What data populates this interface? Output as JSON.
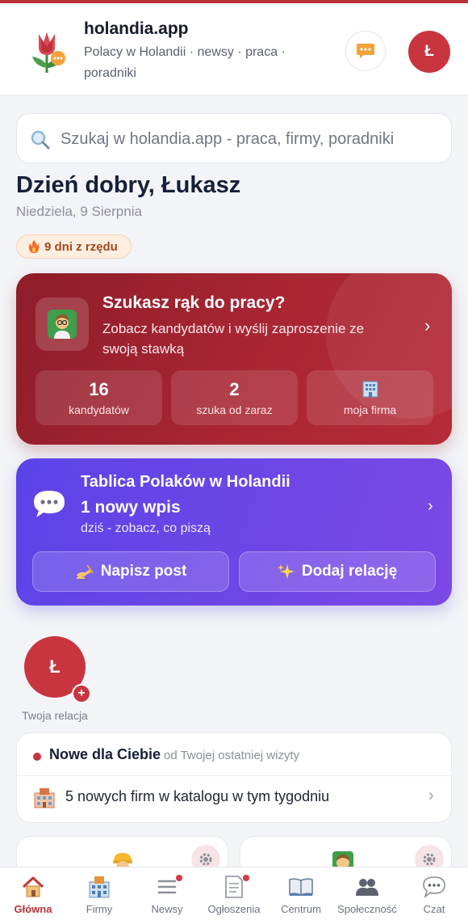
{
  "header": {
    "title": "holandia.app",
    "subtitle": "Polacy w Holandii · newsy · praca · poradniki",
    "avatar_initial": "Ł"
  },
  "search": {
    "placeholder": "Szukaj w holandia.app - praca, firmy, poradniki"
  },
  "greeting": {
    "title": "Dzień dobry, Łukasz",
    "date": "Niedziela, 9 Sierpnia",
    "streak": "9 dni z rzędu"
  },
  "employer_card": {
    "title": "Szukasz rąk do pracy?",
    "subtitle": "Zobacz kandydatów i wyślij zaproszenie ze swoją stawką",
    "stats": [
      {
        "value": "16",
        "label": "kandydatów"
      },
      {
        "value": "2",
        "label": "szuka od zaraz"
      },
      {
        "value": "",
        "label": "moja firma",
        "icon": "office-building-icon"
      }
    ]
  },
  "board_card": {
    "title": "Tablica Polaków w Holandii",
    "new_posts": "1 nowy wpis",
    "subtitle": "dziś - zobacz, co piszą",
    "write_post": "Napisz post",
    "add_story": "Dodaj relację"
  },
  "story": {
    "initial": "Ł",
    "label": "Twoja relacja"
  },
  "new_for_you": {
    "title": "Nowe dla Ciebie",
    "subtitle": "od Twojej ostatniej wizyty",
    "items": [
      {
        "text": "5 nowych firm w katalogu w tym tygodniu",
        "icon": "building-icon"
      }
    ]
  },
  "bottom_nav": [
    {
      "label": "Główna",
      "icon": "home-icon",
      "active": true
    },
    {
      "label": "Firmy",
      "icon": "building-icon"
    },
    {
      "label": "Newsy",
      "icon": "menu-icon",
      "badge": true
    },
    {
      "label": "Ogłoszenia",
      "icon": "document-icon",
      "badge": true
    },
    {
      "label": "Centrum",
      "icon": "book-icon"
    },
    {
      "label": "Społeczność",
      "icon": "people-icon"
    },
    {
      "label": "Czat",
      "icon": "chat-icon"
    }
  ],
  "colors": {
    "brand": "#b8323a",
    "employer_card": "#a52432",
    "board_card": "#6546e6"
  }
}
